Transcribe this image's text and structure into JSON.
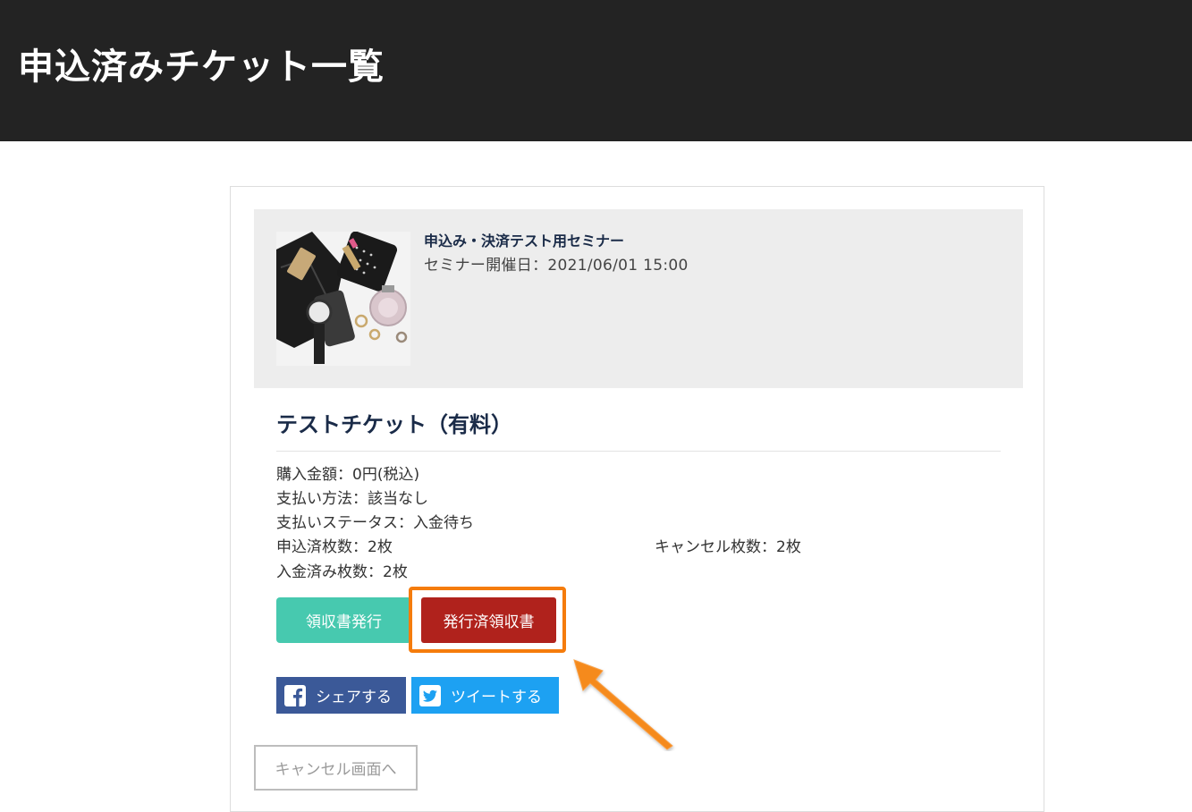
{
  "header": {
    "title": "申込済みチケット一覧"
  },
  "event": {
    "name": "申込み・決済テスト用セミナー",
    "date_label": "セミナー開催日：2021/06/01 15:00"
  },
  "ticket": {
    "title": "テストチケット（有料）",
    "purchase_amount": "購入金額：0円(税込)",
    "payment_method": "支払い方法：該当なし",
    "payment_status": "支払いステータス：入金待ち",
    "applied_count": "申込済枚数：2枚",
    "cancel_count": "キャンセル枚数：2枚",
    "paid_count": "入金済み枚数：2枚"
  },
  "actions": {
    "receipt_issue_label": "領収書発行",
    "issued_receipt_label": "発行済領収書",
    "share_facebook_label": "シェアする",
    "share_twitter_label": "ツイートする",
    "cancel_page_label": "キャンセル画面へ"
  },
  "colors": {
    "header_bg": "#232323",
    "receipt_button": "#47c9af",
    "issued_button": "#b0221c",
    "highlight": "#f57c0c",
    "facebook": "#3b5998",
    "twitter": "#1da1f2"
  },
  "icons": {
    "facebook": "facebook-icon",
    "twitter": "twitter-icon",
    "annotation": "arrow-annotation-icon"
  }
}
